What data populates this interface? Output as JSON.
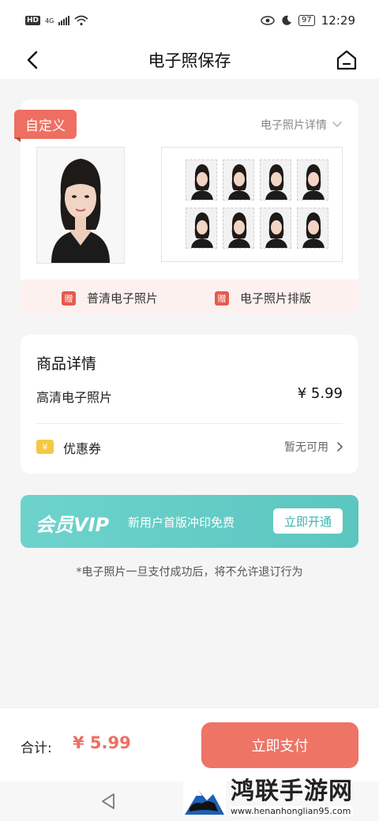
{
  "status_bar": {
    "hd": "HD",
    "network": "4G",
    "battery": "97",
    "time": "12:29"
  },
  "nav": {
    "title": "电子照保存",
    "back_icon": "chevron-left-icon",
    "home_icon": "home-icon"
  },
  "photo_card": {
    "tag": "自定义",
    "detail_link": "电子照片详情",
    "gifts": [
      {
        "badge": "赠",
        "label": "普清电子照片"
      },
      {
        "badge": "赠",
        "label": "电子照片排版"
      }
    ]
  },
  "goods": {
    "title": "商品详情",
    "item_name": "高清电子照片",
    "item_price": "¥ 5.99",
    "coupon_badge": "¥",
    "coupon_label": "优惠券",
    "coupon_status": "暂无可用"
  },
  "vip": {
    "title": "会员VIP",
    "desc": "新用户首版冲印免费",
    "button": "立即开通"
  },
  "notice": "*电子照片一旦支付成功后，将不允许退订行为",
  "bottom": {
    "total_label": "合计:",
    "total_value": "¥ 5.99",
    "pay_button": "立即支付"
  },
  "watermark": {
    "name": "鸿联手游网",
    "url": "www.henanhonglian95.com"
  },
  "colors": {
    "accent": "#ee6f61",
    "vip": "#63cbc4"
  }
}
